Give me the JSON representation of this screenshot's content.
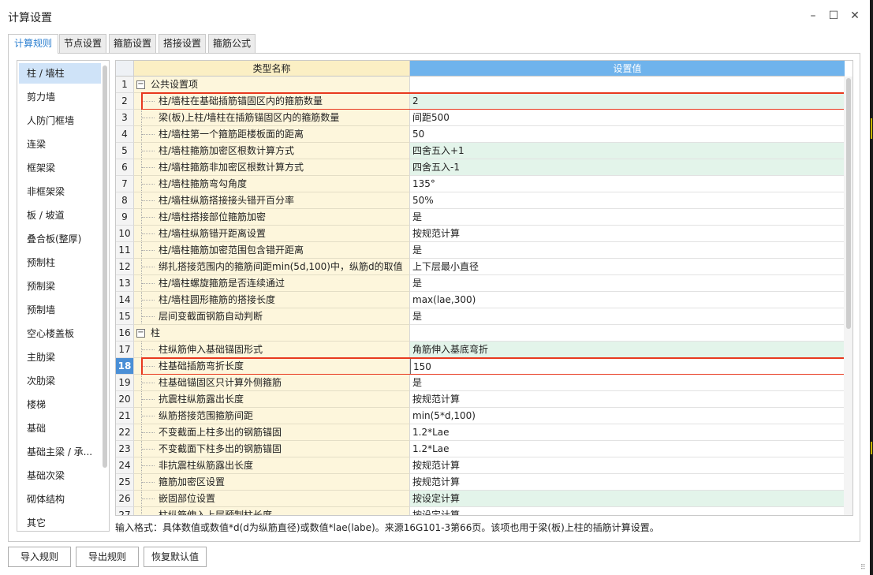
{
  "window": {
    "title": "计算设置",
    "minimize_icon": "minimize-icon",
    "maximize_icon": "maximize-icon",
    "close_icon": "close-icon"
  },
  "tabs": [
    "计算规则",
    "节点设置",
    "箍筋设置",
    "搭接设置",
    "箍筋公式"
  ],
  "active_tab": "计算规则",
  "sidebar": {
    "items": [
      "柱 / 墙柱",
      "剪力墙",
      "人防门框墙",
      "连梁",
      "框架梁",
      "非框架梁",
      "板 / 坡道",
      "叠合板(整厚)",
      "预制柱",
      "预制梁",
      "预制墙",
      "空心楼盖板",
      "主肋梁",
      "次肋梁",
      "楼梯",
      "基础",
      "基础主梁 / 承...",
      "基础次梁",
      "砌体结构",
      "其它"
    ],
    "selected": "柱 / 墙柱"
  },
  "grid": {
    "header": {
      "name": "类型名称",
      "value": "设置值"
    },
    "selected_row": "18",
    "rows": [
      {
        "num": "1",
        "name": "公共设置项",
        "value": "",
        "group": true,
        "expand": "−"
      },
      {
        "num": "2",
        "name": "柱/墙柱在基础插筋锚固区内的箍筋数量",
        "value": "2",
        "hl": true
      },
      {
        "num": "3",
        "name": "梁(板)上柱/墙柱在插筋锚固区内的箍筋数量",
        "value": "间距500"
      },
      {
        "num": "4",
        "name": "柱/墙柱第一个箍筋距楼板面的距离",
        "value": "50"
      },
      {
        "num": "5",
        "name": "柱/墙柱箍筋加密区根数计算方式",
        "value": "四舍五入+1",
        "hl": true
      },
      {
        "num": "6",
        "name": "柱/墙柱箍筋非加密区根数计算方式",
        "value": "四舍五入-1",
        "hl": true
      },
      {
        "num": "7",
        "name": "柱/墙柱箍筋弯勾角度",
        "value": "135°"
      },
      {
        "num": "8",
        "name": "柱/墙柱纵筋搭接接头错开百分率",
        "value": "50%"
      },
      {
        "num": "9",
        "name": "柱/墙柱搭接部位箍筋加密",
        "value": "是"
      },
      {
        "num": "10",
        "name": "柱/墙柱纵筋错开距离设置",
        "value": "按规范计算"
      },
      {
        "num": "11",
        "name": "柱/墙柱箍筋加密范围包含错开距离",
        "value": "是"
      },
      {
        "num": "12",
        "name": "绑扎搭接范围内的箍筋间距min(5d,100)中，纵筋d的取值",
        "value": "上下层最小直径"
      },
      {
        "num": "13",
        "name": "柱/墙柱螺旋箍筋是否连续通过",
        "value": "是"
      },
      {
        "num": "14",
        "name": "柱/墙柱圆形箍筋的搭接长度",
        "value": "max(lae,300)"
      },
      {
        "num": "15",
        "name": "层间变截面钢筋自动判断",
        "value": "是"
      },
      {
        "num": "16",
        "name": "柱",
        "value": "",
        "group": true,
        "expand": "−"
      },
      {
        "num": "17",
        "name": "柱纵筋伸入基础锚固形式",
        "value": "角筋伸入基底弯折",
        "hl": true
      },
      {
        "num": "18",
        "name": "柱基础插筋弯折长度",
        "value": "150",
        "edit": true
      },
      {
        "num": "19",
        "name": "柱基础锚固区只计算外侧箍筋",
        "value": "是"
      },
      {
        "num": "20",
        "name": "抗震柱纵筋露出长度",
        "value": "按规范计算"
      },
      {
        "num": "21",
        "name": "纵筋搭接范围箍筋间距",
        "value": "min(5*d,100)"
      },
      {
        "num": "22",
        "name": "不变截面上柱多出的钢筋锚固",
        "value": "1.2*Lae"
      },
      {
        "num": "23",
        "name": "不变截面下柱多出的钢筋锚固",
        "value": "1.2*Lae"
      },
      {
        "num": "24",
        "name": "非抗震柱纵筋露出长度",
        "value": "按规范计算"
      },
      {
        "num": "25",
        "name": "箍筋加密区设置",
        "value": "按规范计算"
      },
      {
        "num": "26",
        "name": "嵌固部位设置",
        "value": "按设定计算",
        "hl": true
      },
      {
        "num": "27",
        "name": "柱纵筋伸入上层预制柱长度",
        "value": "按设定计算"
      }
    ]
  },
  "hint": "输入格式：具体数值或数值*d(d为纵筋直径)或数值*lae(labe)。来源16G101-3第66页。该项也用于梁(板)上柱的插筋计算设置。",
  "buttons": {
    "import": "导入规则",
    "export": "导出规则",
    "restore": "恢复默认值"
  },
  "colors": {
    "accent": "#2c7fd0",
    "header_value_bg": "#6fb3ec",
    "name_cell_bg": "#fdf6dc",
    "highlight_row_bg": "#e3f4ea",
    "annotation_red": "#e8391f"
  }
}
